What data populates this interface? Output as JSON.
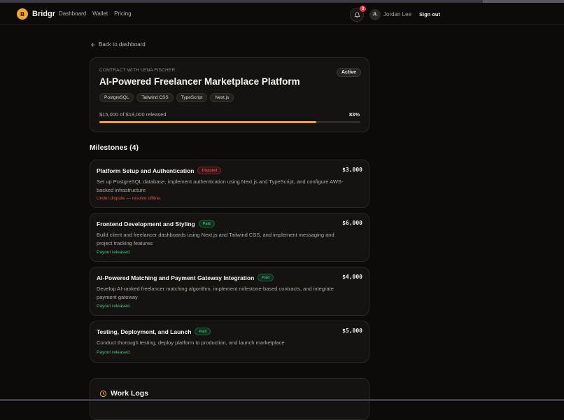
{
  "app": {
    "name": "Bridgr",
    "logo_letter": "B",
    "accent": "#f0a830"
  },
  "nav": {
    "links": [
      "Dashboard",
      "Wallet",
      "Pricing"
    ]
  },
  "header": {
    "notification_count": "3",
    "user_initials": "JL",
    "user_name": "Jordan Lee",
    "sign_out": "Sign out"
  },
  "back_link": "Back to dashboard",
  "contract": {
    "with_label": "CONTRACT WITH LENA FISCHER",
    "title": "AI-Powered Freelancer Marketplace Platform",
    "status": "Active",
    "tags": [
      "PostgreSQL",
      "Tailwind CSS",
      "TypeScript",
      "Next.js"
    ],
    "released_text": "$15,000 of $18,000 released",
    "percent_label": "83%",
    "progress_fraction": 0.83
  },
  "milestones_heading": "Milestones (4)",
  "milestones": [
    {
      "title": "Platform Setup and Authentication",
      "status": "Disputed",
      "amount": "$3,000",
      "description": "Set up PostgreSQL database, implement authentication using Next.js and TypeScript, and configure AWS-backed infrastructure",
      "note": "Under dispute — resolve offline."
    },
    {
      "title": "Frontend Development and Styling",
      "status": "Paid",
      "amount": "$6,000",
      "description": "Build client and freelancer dashboards using Next.js and Tailwind CSS, and implement messaging and project tracking features",
      "note": "Payout released."
    },
    {
      "title": "AI-Powered Matching and Payment Gateway Integration",
      "status": "Paid",
      "amount": "$4,000",
      "description": "Develop AI-ranked freelancer matching algorithm, implement milestone-based contracts, and integrate payment gateway",
      "note": "Payout released."
    },
    {
      "title": "Testing, Deployment, and Launch",
      "status": "Paid",
      "amount": "$5,000",
      "description": "Conduct thorough testing, deploy platform to production, and launch marketplace",
      "note": "Payout released."
    }
  ],
  "work_logs_title": "Work Logs",
  "icons": [
    "bell-icon",
    "arrow-left-icon",
    "clock-icon"
  ]
}
